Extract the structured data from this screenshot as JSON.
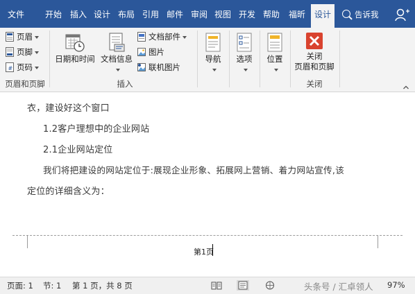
{
  "tabs": [
    "文件",
    "开始",
    "插入",
    "设计",
    "布局",
    "引用",
    "邮件",
    "审阅",
    "视图",
    "开发",
    "帮助",
    "福昕",
    "设计"
  ],
  "tell_me": "告诉我",
  "ribbon": {
    "header_footer_group": {
      "header": "页眉",
      "footer": "页脚",
      "page_number": "页码",
      "label": "页眉和页脚"
    },
    "insert_group": {
      "date_time": "日期和时间",
      "doc_info": "文档信息",
      "doc_parts": "文档部件",
      "picture": "图片",
      "online_picture": "联机图片",
      "label": "插入"
    },
    "nav": "导航",
    "options": "选项",
    "position": "位置",
    "close_group": {
      "close_line1": "关闭",
      "close_line2": "页眉和页脚",
      "label": "关闭"
    }
  },
  "document": {
    "lines": [
      "衣，建设好这个窗口",
      "1.2客户理想中的企业网站",
      "2.1企业网站定位",
      "我们将把建设的网站定位于:展现企业形象、拓展网上营销、着力网站宣传,该",
      "定位的详细含义为："
    ],
    "footer_page": "第1页"
  },
  "status": {
    "page": "页面: 1",
    "section": "节: 1",
    "count": "第 1 页，共 8 页",
    "zoom": "97%"
  },
  "watermark": "头条号 / 汇卓领人",
  "colors": {
    "accent": "#2b579a",
    "close_red": "#d9432f"
  }
}
